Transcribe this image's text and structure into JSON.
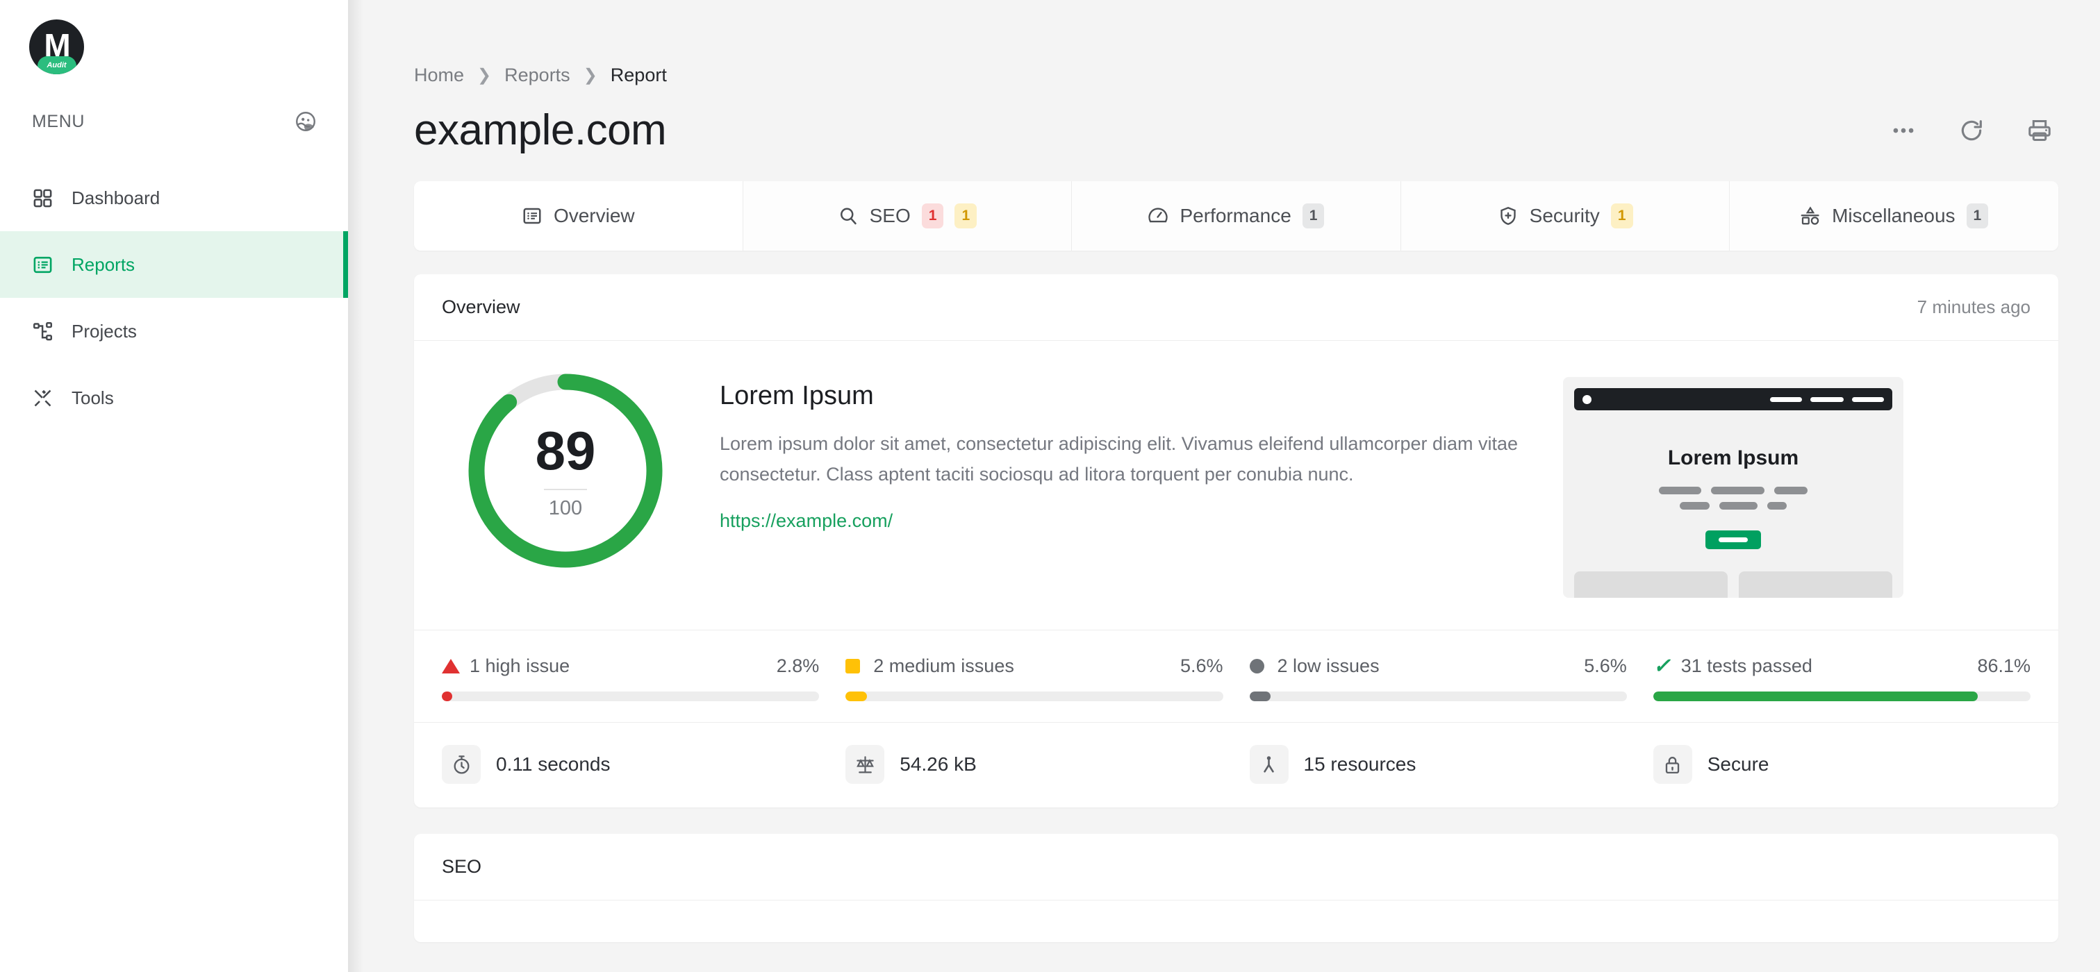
{
  "brand": {
    "logo_letter": "M",
    "logo_badge_text": "Audit",
    "accent": "#00a563",
    "accent_dark": "#17a05e"
  },
  "sidebar": {
    "menu_label": "MENU",
    "menu_head_icon": "face-mask-icon",
    "items": [
      {
        "label": "Dashboard",
        "icon": "grid-icon",
        "active": false
      },
      {
        "label": "Reports",
        "icon": "list-panel-icon",
        "active": true
      },
      {
        "label": "Projects",
        "icon": "sitemap-icon",
        "active": false
      },
      {
        "label": "Tools",
        "icon": "tools-icon",
        "active": false
      }
    ]
  },
  "breadcrumb": {
    "items": [
      "Home",
      "Reports",
      "Report"
    ],
    "separator": "❯"
  },
  "header": {
    "title": "example.com",
    "actions": [
      {
        "name": "more-options-button",
        "icon": "ellipsis-icon"
      },
      {
        "name": "refresh-button",
        "icon": "refresh-icon"
      },
      {
        "name": "print-button",
        "icon": "print-icon"
      }
    ]
  },
  "tabs": [
    {
      "label": "Overview",
      "icon": "list-panel-icon",
      "active": true,
      "badges": []
    },
    {
      "label": "SEO",
      "icon": "search-icon",
      "active": false,
      "badges": [
        {
          "value": "1",
          "tone": "red"
        },
        {
          "value": "1",
          "tone": "yellow"
        }
      ]
    },
    {
      "label": "Performance",
      "icon": "gauge-icon",
      "active": false,
      "badges": [
        {
          "value": "1",
          "tone": "gray"
        }
      ]
    },
    {
      "label": "Security",
      "icon": "shield-icon",
      "active": false,
      "badges": [
        {
          "value": "1",
          "tone": "yellow"
        }
      ]
    },
    {
      "label": "Miscellaneous",
      "icon": "shapes-icon",
      "active": false,
      "badges": [
        {
          "value": "1",
          "tone": "gray"
        }
      ]
    }
  ],
  "overview": {
    "card_title": "Overview",
    "card_meta": "7 minutes ago",
    "score": {
      "value": "89",
      "max": "100",
      "percent": 89,
      "ring_color": "#2aa646",
      "track_color": "#e4e4e4"
    },
    "summary": {
      "title": "Lorem Ipsum",
      "description": "Lorem ipsum dolor sit amet, consectetur adipiscing elit. Vivamus eleifend ullamcorper diam vitae consectetur. Class aptent taciti sociosqu ad litora torquent per conubia nunc.",
      "link": "https://example.com/"
    },
    "preview": {
      "heading": "Lorem Ipsum",
      "button_icon": "placeholder-bar",
      "browser_dot": "window-dot"
    },
    "issues": [
      {
        "label": "1 high issue",
        "percent_text": "2.8%",
        "bar_percent": 2.8,
        "mark": "triangle",
        "color": "#e03131"
      },
      {
        "label": "2 medium issues",
        "percent_text": "5.6%",
        "bar_percent": 5.6,
        "mark": "square",
        "color": "#ffc107"
      },
      {
        "label": "2 low issues",
        "percent_text": "5.6%",
        "bar_percent": 5.6,
        "mark": "circle",
        "color": "#6f7378"
      },
      {
        "label": "31 tests passed",
        "percent_text": "86.1%",
        "bar_percent": 86.1,
        "mark": "check",
        "color": "#2aa646"
      }
    ],
    "metrics": [
      {
        "label": "0.11 seconds",
        "icon": "stopwatch-icon"
      },
      {
        "label": "54.26 kB",
        "icon": "scale-icon"
      },
      {
        "label": "15 resources",
        "icon": "sitemap-icon"
      },
      {
        "label": "Secure",
        "icon": "lock-icon"
      }
    ]
  },
  "seo_section": {
    "card_title": "SEO"
  }
}
